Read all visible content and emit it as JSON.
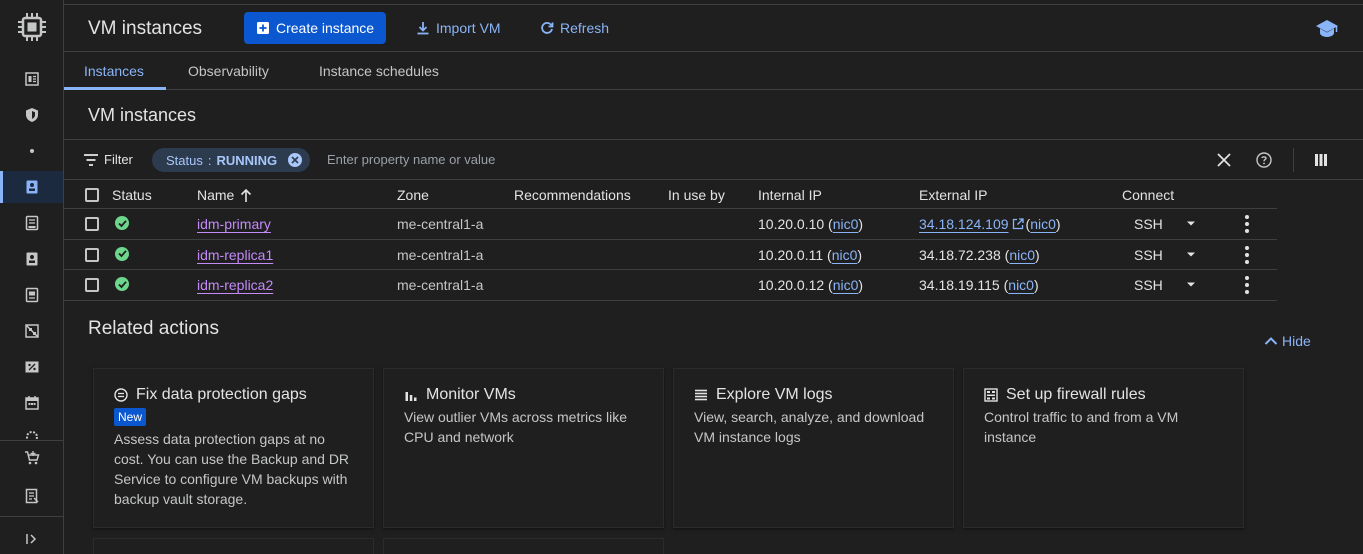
{
  "header": {
    "title": "VM instances",
    "create_label": "Create instance",
    "import_label": "Import VM",
    "refresh_label": "Refresh"
  },
  "tabs": [
    {
      "label": "Instances",
      "active": true
    },
    {
      "label": "Observability",
      "active": false
    },
    {
      "label": "Instance schedules",
      "active": false
    }
  ],
  "section_title": "VM instances",
  "filter": {
    "label": "Filter",
    "chip_key": "Status",
    "chip_sep": ":",
    "chip_value": "RUNNING",
    "placeholder": "Enter property name or value"
  },
  "table": {
    "columns": [
      "Status",
      "Name",
      "Zone",
      "Recommendations",
      "In use by",
      "Internal IP",
      "External IP",
      "Connect"
    ],
    "rows": [
      {
        "name": "idm-primary",
        "zone": "me-central1-a",
        "internal_ip": "10.20.0.10",
        "internal_nic": "nic0",
        "external_ip": "34.18.124.109",
        "external_linked": true,
        "external_nic": "nic0",
        "connect": "SSH"
      },
      {
        "name": "idm-replica1",
        "zone": "me-central1-a",
        "internal_ip": "10.20.0.11",
        "internal_nic": "nic0",
        "external_ip": "34.18.72.238",
        "external_linked": false,
        "external_nic": "nic0",
        "connect": "SSH"
      },
      {
        "name": "idm-replica2",
        "zone": "me-central1-a",
        "internal_ip": "10.20.0.12",
        "internal_nic": "nic0",
        "external_ip": "34.18.19.115",
        "external_linked": false,
        "external_nic": "nic0",
        "connect": "SSH"
      }
    ]
  },
  "related": {
    "title": "Related actions",
    "hide_label": "Hide",
    "cards": [
      {
        "title": "Fix data protection gaps",
        "badge": "New",
        "desc": "Assess data protection gaps at no cost. You can use the Backup and DR Service to configure VM backups with backup vault storage.",
        "icon": "shield-check-icon"
      },
      {
        "title": "Monitor VMs",
        "desc": "View outlier VMs across metrics like CPU and network",
        "icon": "bar-chart-icon"
      },
      {
        "title": "Explore VM logs",
        "desc": "View, search, analyze, and download VM instance logs",
        "icon": "list-icon"
      },
      {
        "title": "Set up firewall rules",
        "desc": "Control traffic to and from a VM instance",
        "icon": "firewall-icon"
      }
    ]
  },
  "colors": {
    "accent": "#8ab4f8",
    "primary_button": "#0b57d0",
    "running_status": "#6dd58c",
    "name_link": "#c58af9",
    "background": "#1f1f1f"
  }
}
